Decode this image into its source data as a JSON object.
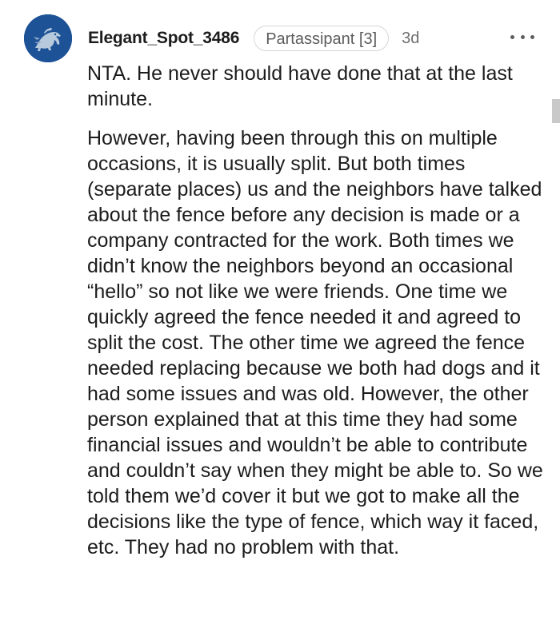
{
  "comment": {
    "author": "Elegant_Spot_3486",
    "flair": "Partassipant [3]",
    "age": "3d",
    "more_icon": "ellipsis-horizontal",
    "avatar_icon": "lion-logo",
    "avatar_color": "#1b4e91",
    "paragraphs": [
      "NTA. He never should have done that at the last minute.",
      "However, having been through this on multiple occasions, it is usually split. But both times (separate places) us and the neighbors have talked about the fence before any decision is made or a company contracted for the work. Both times we didn’t know the neighbors beyond an occasional “hello” so not like we were friends. One time we quickly agreed the fence needed it and agreed to split the cost. The other time we agreed the fence needed replacing because we both had dogs and it had some issues and was old. However, the other person explained that at this time they had some financial issues and wouldn’t be able to contribute and couldn’t say when they might be able to. So we told them we’d cover it but we got to make all the decisions like the type of fence, which way it faced, etc. They had no problem with that."
    ]
  }
}
